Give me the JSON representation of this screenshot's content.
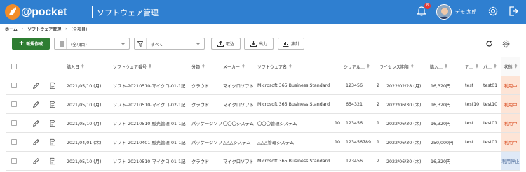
{
  "app": {
    "logo_text": "@pocket",
    "logo_sub": "",
    "title": "ソフトウェア管理",
    "notification_count": "8",
    "user_name": "デモ 太郎"
  },
  "breadcrumb": [
    "ホーム",
    "ソフトウェア管理",
    "(全項目)"
  ],
  "toolbar": {
    "new_label": "新規作成",
    "columns_select": "(全項目)",
    "filter_select": "すべて",
    "import_label": "取込",
    "export_label": "出力",
    "total_label": "集計"
  },
  "table": {
    "headers": [
      "購入日",
      "ソフトウェア番号",
      "分類",
      "メーカー",
      "ソフトウェア名",
      "シリアル…",
      "ライセンス期限",
      "購入…",
      "ア…",
      "パ…",
      "状態"
    ],
    "rows": [
      {
        "date": "2021/05/10 (月)",
        "number": "ソフト-20210510-マイクロ-01-1記",
        "category": "クラウド",
        "maker": "マイクロソフト",
        "name": "Microsoft 365 Business Standard",
        "qty": "",
        "serial": "123456",
        "n2": "2",
        "expiry": "2022/02/28 (月)",
        "price": "16,320円",
        "a": "test",
        "p": "test01",
        "status": "利用中"
      },
      {
        "date": "2021/05/10 (月)",
        "number": "ソフト-20210510-マイクロ-02-1記",
        "category": "クラウド",
        "maker": "マイクロソフト",
        "name": "Microsoft 365 Business Standard",
        "qty": "",
        "serial": "654321",
        "n2": "2",
        "expiry": "2022/06/30 (木)",
        "price": "16,320円",
        "a": "test10",
        "p": "test10",
        "status": "利用中"
      },
      {
        "date": "2021/05/10 (月)",
        "number": "ソフト-20210510-販売管理-01-1記",
        "category": "パッケージソフト",
        "maker": "〇〇〇システム",
        "name": "〇〇〇管理システム",
        "qty": "10",
        "serial": "123456",
        "n2": "1",
        "expiry": "2022/06/30 (木)",
        "price": "16,320円",
        "a": "test",
        "p": "test01",
        "status": "利用中"
      },
      {
        "date": "2021/04/01 (木)",
        "number": "ソフト-20210401-販売管理-01-1記",
        "category": "パッケージソフト",
        "maker": "△△△システム",
        "name": "△△△管理システム",
        "qty": "10",
        "serial": "123456789",
        "n2": "1",
        "expiry": "2022/06/30 (木)",
        "price": "250,000円",
        "a": "test",
        "p": "test01",
        "status": "利用中"
      },
      {
        "date": "2021/05/10 (月)",
        "number": "ソフト-20210510-マイクロ-01-1記",
        "category": "クラウド",
        "maker": "マイクロソフト",
        "name": "Microsoft 365 Business Standard",
        "qty": "",
        "serial": "123456",
        "n2": "2",
        "expiry": "2022/06/30 (木)",
        "price": "16,320円",
        "a": "",
        "p": "",
        "status": "利用停止"
      }
    ]
  },
  "colors": {
    "header_bg": "#2f7fd0",
    "new_button": "#2e7d32",
    "status_active_bg": "#fde4d6",
    "status_active_text": "#d84315",
    "status_stopped_bg": "#dfe9f7"
  }
}
